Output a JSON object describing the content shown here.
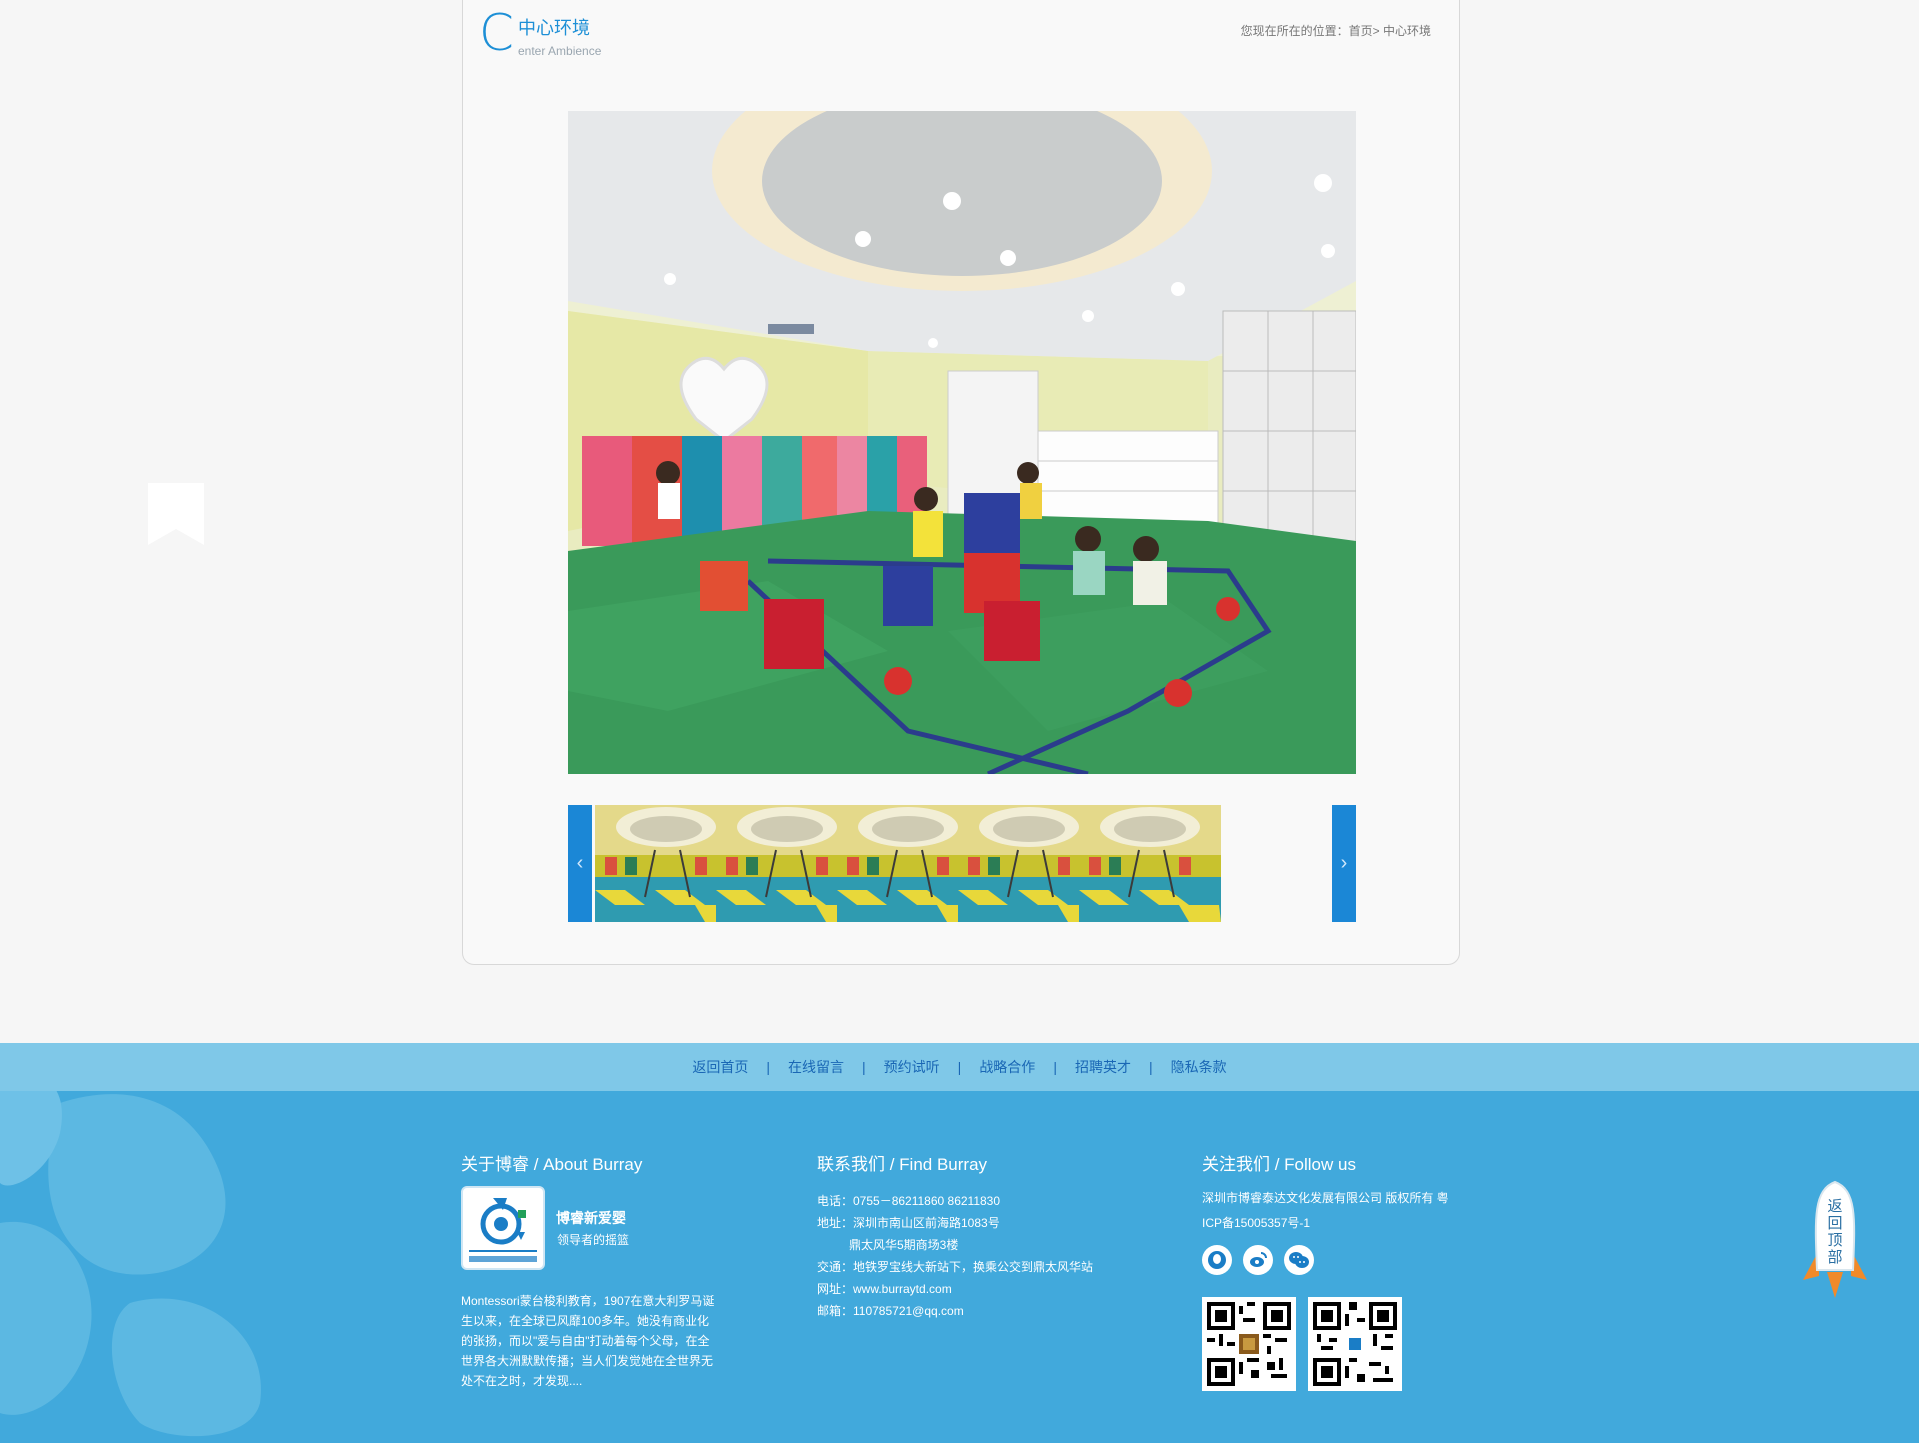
{
  "section": {
    "big_letter": "C",
    "title_cn": "中心环境",
    "title_en": "enter Ambience"
  },
  "breadcrumb": {
    "prefix": "您现在所在的位置：",
    "home": "首页",
    "separator": "> ",
    "current": "中心环境"
  },
  "gallery": {
    "prev_icon": "chevron-left-icon",
    "next_icon": "chevron-right-icon",
    "prev_glyph": "‹",
    "next_glyph": "›",
    "thumb_count": 5
  },
  "footer_nav": [
    {
      "label": "返回首页"
    },
    {
      "label": "在线留言"
    },
    {
      "label": "预约试听"
    },
    {
      "label": "战略合作"
    },
    {
      "label": "招聘英才"
    },
    {
      "label": "隐私条款"
    }
  ],
  "footer_nav_separator": "|",
  "about": {
    "heading": "关于博睿 / About Burray",
    "brand": "博睿新爱婴",
    "slogan": "领导者的摇篮",
    "intro": "Montessori蒙台梭利教育，1907在意大利罗马诞生以来，在全球已风靡100多年。她没有商业化的张扬，而以\"爱与自由\"打动着每个父母，在全世界各大洲默默传播；当人们发觉她在全世界无处不在之时，才发现...."
  },
  "contact": {
    "heading": "联系我们 / Find Burray",
    "phone": "电话：0755－86211860  86211830",
    "address": "地址：深圳市南山区前海路1083号",
    "address2": "鼎太风华5期商场3楼",
    "transport": "交通：地铁罗宝线大新站下，换乘公交到鼎太风华站",
    "website": "网址：www.burraytd.com",
    "email": "邮箱：110785721@qq.com"
  },
  "follow": {
    "heading": "关注我们 / Follow us",
    "company": "深圳市博睿泰达文化发展有限公司 版权所有 粤ICP备15005357号-1",
    "social": [
      "qq-icon",
      "weibo-icon",
      "wechat-icon"
    ]
  },
  "back_to_top": {
    "label": "返回顶部"
  },
  "colors": {
    "accent": "#1d8fd6",
    "footer_bg": "#41a9dc",
    "footer_nav_bg": "#7fc8e8",
    "thumb_arrow": "#1b87d6"
  }
}
